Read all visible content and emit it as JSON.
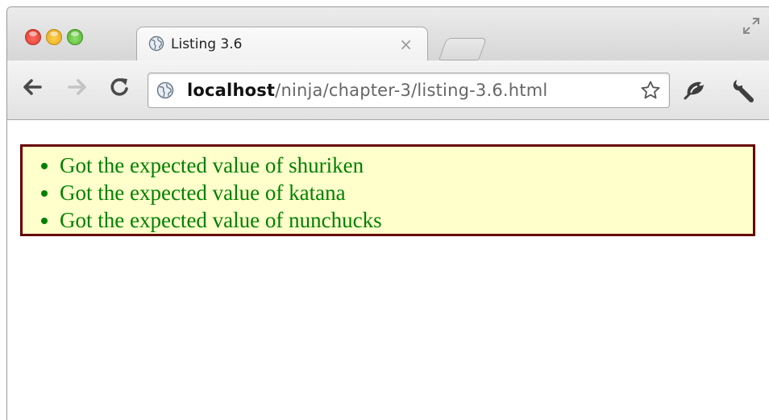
{
  "browser": {
    "tab": {
      "title": "Listing 3.6",
      "close_glyph": "×"
    },
    "url": {
      "host": "localhost",
      "path": "/ninja/chapter-3/listing-3.6.html"
    },
    "icons": {
      "back": "back-arrow-icon",
      "forward": "forward-arrow-icon",
      "reload": "reload-icon",
      "star": "star-icon",
      "extension": "extension-icon",
      "wrench": "wrench-icon"
    }
  },
  "page": {
    "results": [
      "Got the expected value of shuriken",
      "Got the expected value of katana",
      "Got the expected value of nunchucks"
    ],
    "colors": {
      "pass_text": "#008000",
      "box_bg": "#ffffcc",
      "box_border": "#660000"
    }
  }
}
